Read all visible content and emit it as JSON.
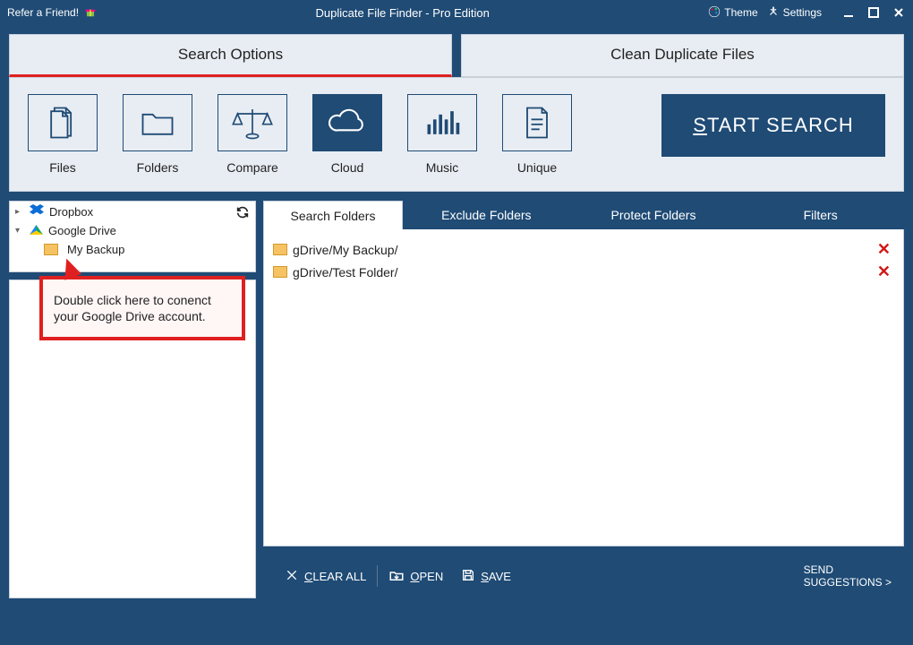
{
  "titlebar": {
    "refer_label": "Refer a Friend!",
    "app_title": "Duplicate File Finder - Pro Edition",
    "theme_label": "Theme",
    "settings_label": "Settings"
  },
  "top_tabs": {
    "search_options": "Search Options",
    "clean_duplicates": "Clean Duplicate Files"
  },
  "categories": {
    "files": "Files",
    "folders": "Folders",
    "compare": "Compare",
    "cloud": "Cloud",
    "music": "Music",
    "unique": "Unique"
  },
  "start_button": {
    "prefix_ul": "S",
    "rest": "TART SEARCH"
  },
  "tree": {
    "dropbox": "Dropbox",
    "google_drive": "Google Drive",
    "my_backup": "My Backup"
  },
  "callout": {
    "text": "Double click here to conenct your Google Drive account."
  },
  "sub_tabs": {
    "search_folders": "Search Folders",
    "exclude_folders": "Exclude Folders",
    "protect_folders": "Protect Folders",
    "filters": "Filters"
  },
  "folders": [
    {
      "path": "gDrive/My Backup/"
    },
    {
      "path": "gDrive/Test Folder/"
    }
  ],
  "bottom": {
    "clear_ul": "C",
    "clear_rest": "LEAR ALL",
    "open_ul": "O",
    "open_rest": "PEN",
    "save_ul": "S",
    "save_rest": "AVE",
    "send_line1": "SEND",
    "send_line2": "SUGGESTIONS >"
  }
}
